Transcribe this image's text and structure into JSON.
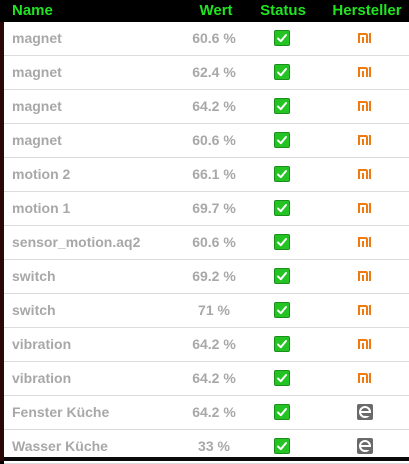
{
  "header": {
    "name": "Name",
    "wert": "Wert",
    "status": "Status",
    "hersteller": "Hersteller"
  },
  "rows": [
    {
      "name": "magnet",
      "wert": "60.6 %",
      "status": "checked",
      "brand": "xiaomi-icon"
    },
    {
      "name": "magnet",
      "wert": "62.4 %",
      "status": "checked",
      "brand": "xiaomi-icon"
    },
    {
      "name": "magnet",
      "wert": "64.2 %",
      "status": "checked",
      "brand": "xiaomi-icon"
    },
    {
      "name": "magnet",
      "wert": "60.6 %",
      "status": "checked",
      "brand": "xiaomi-icon"
    },
    {
      "name": "motion 2",
      "wert": "66.1 %",
      "status": "checked",
      "brand": "xiaomi-icon"
    },
    {
      "name": "motion 1",
      "wert": "69.7 %",
      "status": "checked",
      "brand": "xiaomi-icon"
    },
    {
      "name": "sensor_motion.aq2",
      "wert": "60.6 %",
      "status": "checked",
      "brand": "xiaomi-icon"
    },
    {
      "name": "switch",
      "wert": "69.2 %",
      "status": "checked",
      "brand": "xiaomi-icon"
    },
    {
      "name": "switch",
      "wert": "71 %",
      "status": "checked",
      "brand": "xiaomi-icon"
    },
    {
      "name": "vibration",
      "wert": "64.2 %",
      "status": "checked",
      "brand": "xiaomi-icon"
    },
    {
      "name": "vibration",
      "wert": "64.2 %",
      "status": "checked",
      "brand": "xiaomi-icon"
    },
    {
      "name": "Fenster Küche",
      "wert": "64.2 %",
      "status": "checked",
      "brand": "e-brand-icon"
    },
    {
      "name": "Wasser Küche",
      "wert": "33 %",
      "status": "checked",
      "brand": "e-brand-icon"
    }
  ],
  "colors": {
    "header_text": "#21e321",
    "cell_text": "#a8a8a8",
    "status_green": "#22c322",
    "xiaomi_orange": "#f07a10",
    "e_brand_gray": "#6a6a6a"
  }
}
